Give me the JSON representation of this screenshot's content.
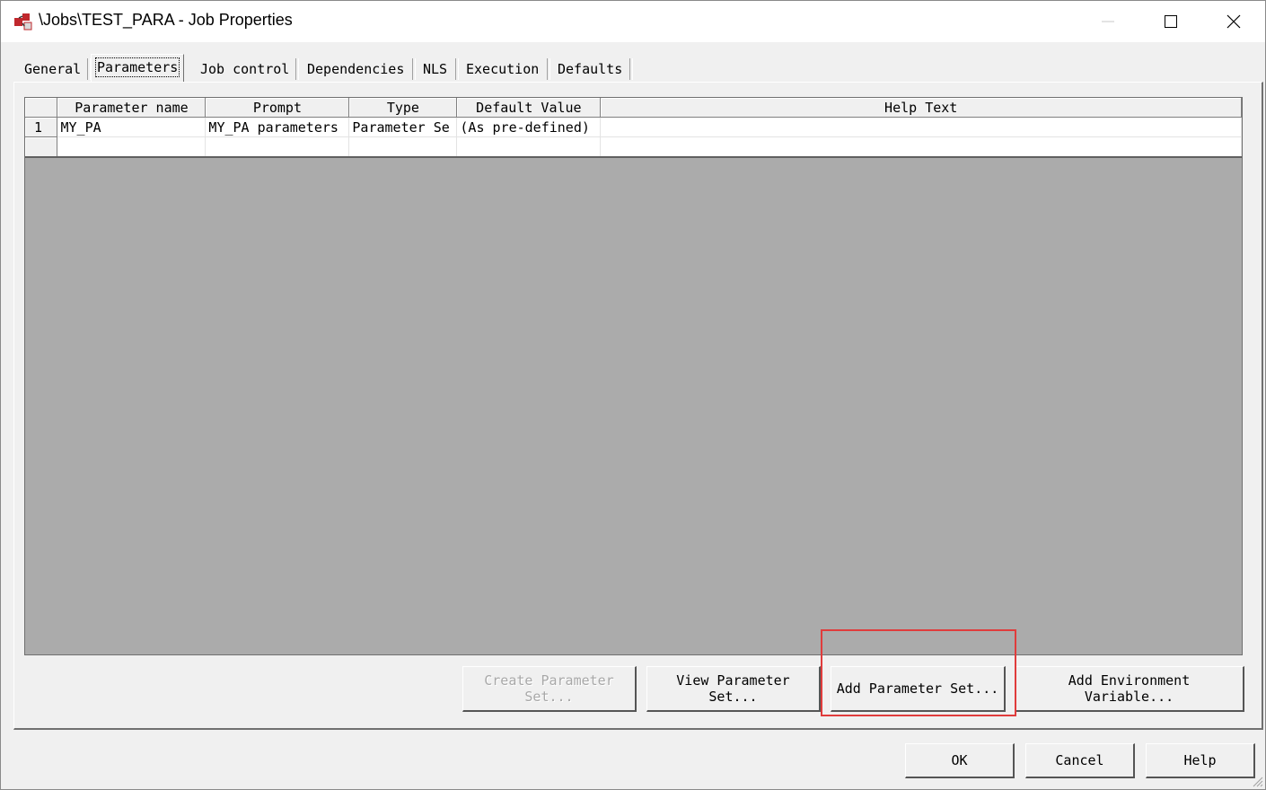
{
  "window": {
    "title": "\\Jobs\\TEST_PARA - Job Properties",
    "icon": "job-properties-icon",
    "controls": [
      "minimize-icon",
      "maximize-icon",
      "close-icon"
    ]
  },
  "tabs": [
    {
      "label": "General",
      "active": false
    },
    {
      "label": "Parameters",
      "active": true
    },
    {
      "label": "Job control",
      "active": false
    },
    {
      "label": "Dependencies",
      "active": false
    },
    {
      "label": "NLS",
      "active": false
    },
    {
      "label": "Execution",
      "active": false
    },
    {
      "label": "Defaults",
      "active": false
    }
  ],
  "grid": {
    "columns": [
      "Parameter name",
      "Prompt",
      "Type",
      "Default Value",
      "Help Text"
    ],
    "rows": [
      {
        "num": "1",
        "cells": [
          "MY_PA",
          "MY_PA parameters",
          "Parameter Se",
          "(As pre-defined)",
          ""
        ]
      },
      {
        "num": "",
        "cells": [
          "",
          "",
          "",
          "",
          ""
        ]
      }
    ]
  },
  "actions": {
    "create_param_set": "Create Parameter\nSet...",
    "view_param_set": "View Parameter\nSet...",
    "add_param_set": "Add Parameter Set...",
    "add_env_var": "Add Environment\nVariable..."
  },
  "footer": {
    "ok": "OK",
    "cancel": "Cancel",
    "help": "Help"
  },
  "colors": {
    "highlight_box": "#e03c3c",
    "grid_background": "#ababab"
  }
}
